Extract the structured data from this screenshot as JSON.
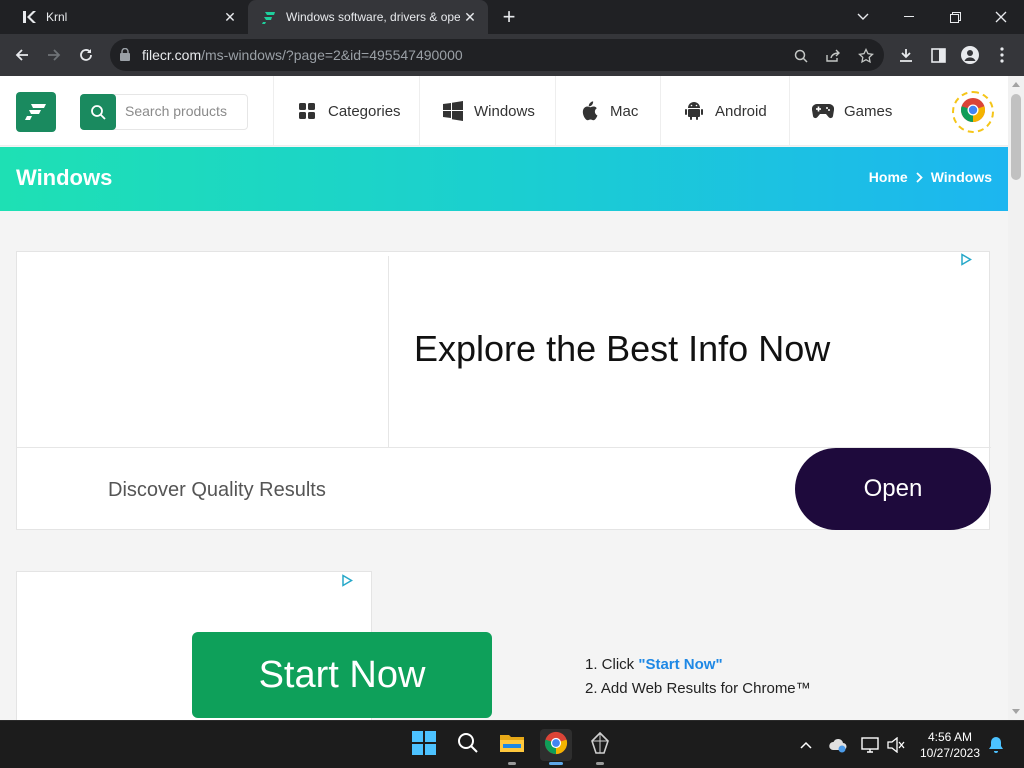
{
  "tabs": [
    {
      "title": "Krnl",
      "active": false
    },
    {
      "title": "Windows software, drivers & ope",
      "active": true
    }
  ],
  "address_bar": {
    "host": "filecr.com",
    "path": "/ms-windows/?page=2&id=495547490000"
  },
  "site": {
    "search_placeholder": "Search products",
    "nav": [
      {
        "label": "Categories",
        "icon": "grid-icon"
      },
      {
        "label": "Windows",
        "icon": "windows-icon"
      },
      {
        "label": "Mac",
        "icon": "apple-icon"
      },
      {
        "label": "Android",
        "icon": "android-icon"
      },
      {
        "label": "Games",
        "icon": "gamepad-icon"
      }
    ],
    "brand_color": "#1a8a5f"
  },
  "hero": {
    "title": "Windows",
    "breadcrumb": [
      "Home",
      "Windows"
    ]
  },
  "ad1": {
    "headline": "Explore the Best Info Now",
    "subline": "Discover Quality Results",
    "button": "Open"
  },
  "ad2": {
    "button": "Start Now",
    "step1_prefix": "1. Click ",
    "step1_highlight": "\"Start Now\"",
    "step2": "2. Add Web Results for Chrome™"
  },
  "taskbar": {
    "time": "4:56 AM",
    "date": "10/27/2023"
  }
}
